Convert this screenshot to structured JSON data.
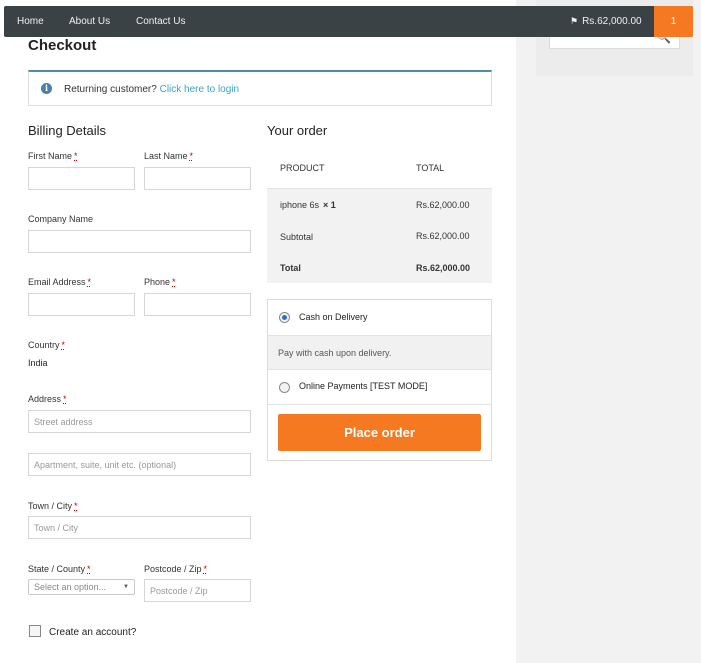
{
  "nav": {
    "links": [
      "Home",
      "About Us",
      "Contact Us"
    ],
    "cart_total": "Rs.62,000.00",
    "cart_count": "1"
  },
  "page_title": "Checkout",
  "notice": {
    "text": "Returning customer?",
    "link": "Click here to login"
  },
  "billing": {
    "title": "Billing Details",
    "first_name_label": "First Name",
    "last_name_label": "Last Name",
    "company_label": "Company Name",
    "email_label": "Email Address",
    "phone_label": "Phone",
    "country_label": "Country",
    "country_value": "India",
    "address_label": "Address",
    "street_placeholder": "Street address",
    "apartment_placeholder": "Apartment, suite, unit etc. (optional)",
    "town_label": "Town / City",
    "town_placeholder": "Town / City",
    "state_label": "State / County",
    "state_placeholder": "Select an option...",
    "postcode_label": "Postcode / Zip",
    "postcode_placeholder": "Postcode / Zip",
    "required_mark": "*",
    "create_account_label": "Create an account?"
  },
  "order": {
    "title": "Your order",
    "col_product": "PRODUCT",
    "col_total": "TOTAL",
    "item_name": "iphone 6s",
    "item_qty": "× 1",
    "item_total": "Rs.62,000.00",
    "subtotal_label": "Subtotal",
    "subtotal_value": "Rs.62,000.00",
    "total_label": "Total",
    "total_value": "Rs.62,000.00"
  },
  "payment": {
    "cod_label": "Cash on Delivery",
    "cod_desc": "Pay with cash upon delivery.",
    "online_label": "Online Payments [TEST MODE]",
    "place_order": "Place order"
  },
  "colors": {
    "accent": "#f47920",
    "navbar": "#3a4246",
    "link": "#3aa5c4"
  },
  "icons": {
    "info": "info-icon",
    "cart_flag": "flag-icon",
    "search": "search-icon",
    "dropdown": "chevron-down-icon"
  }
}
